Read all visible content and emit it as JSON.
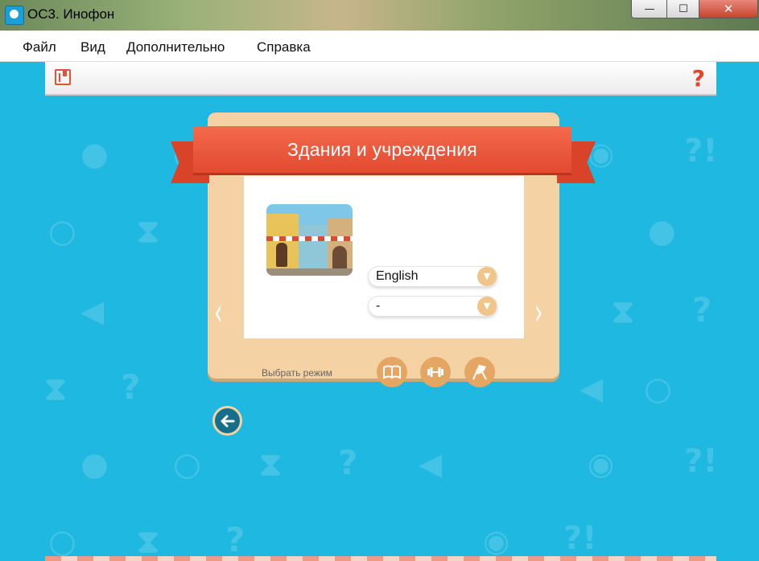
{
  "window": {
    "title": "ОС3. Инофон",
    "controls": {
      "minimize": "—",
      "maximize": "☐",
      "close": "✕"
    }
  },
  "menu": {
    "items": [
      "Файл",
      "Вид",
      "Дополнительно",
      "Справка"
    ]
  },
  "toolbar": {
    "book_icon": "book-icon",
    "help_label": "?"
  },
  "dialog": {
    "title": "Здания и учреждения",
    "language_select": {
      "value": "English"
    },
    "second_select": {
      "value": "-"
    },
    "mode_label": "Выбрать режим",
    "modes": [
      "book-icon",
      "dumbbell-icon",
      "racing-flags-icon"
    ],
    "nav_prev": "‹",
    "nav_next": "›"
  },
  "colors": {
    "background": "#1fb8e0",
    "ribbon": "#e34a2f",
    "card": "#f4d2a3",
    "mode_button": "#e5a664",
    "back_button": "#166f8a"
  }
}
